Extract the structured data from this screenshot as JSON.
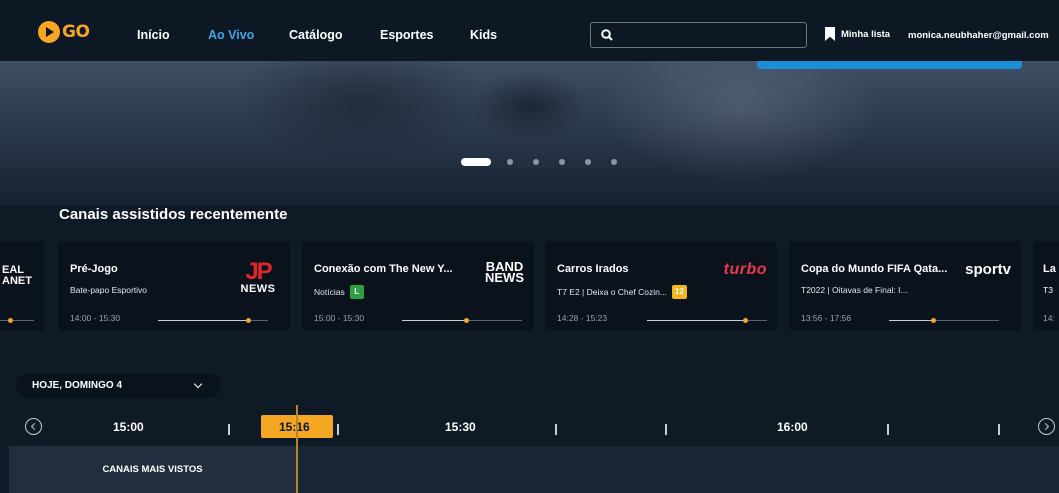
{
  "brand": {
    "logo_text": "GO"
  },
  "nav": {
    "items": [
      {
        "label": "Início",
        "active": false
      },
      {
        "label": "Ao Vivo",
        "active": true
      },
      {
        "label": "Catálogo",
        "active": false
      },
      {
        "label": "Esportes",
        "active": false
      },
      {
        "label": "Kids",
        "active": false
      }
    ],
    "search": {
      "placeholder": "",
      "value": ""
    },
    "my_list": "Minha lista",
    "user_email": "monica.neubhaher@gmail.com"
  },
  "hero": {
    "carousel_dots": 6,
    "active_dot": 0
  },
  "recent": {
    "title": "Canais assistidos recentemente",
    "partial_left": {
      "logo_line1": "EAL",
      "logo_line2": "ANET"
    },
    "cards": [
      {
        "title": "Pré-Jogo",
        "subtitle": "Bate-papo Esportivo",
        "badge": "",
        "time": "14:00 - 15:30",
        "progress": 0.82,
        "channel_logo": "jp-news-logo",
        "logo_text_1": "JP",
        "logo_text_2": "NEWS"
      },
      {
        "title": "Conexão com The New Y...",
        "subtitle": "Notícias",
        "badge": "L",
        "time": "15:00 - 15:30",
        "progress": 0.53,
        "channel_logo": "band-news-logo",
        "logo_text_1": "BAND",
        "logo_text_2": "NEWS"
      },
      {
        "title": "Carros Irados",
        "subtitle": "T7 E2 | Deixa o Chef Cozin...",
        "badge": "12",
        "time": "14:28 - 15:23",
        "progress": 0.82,
        "channel_logo": "discovery-turbo-logo",
        "logo_text_1": "turbo",
        "logo_text_2": ""
      },
      {
        "title": "Copa do Mundo FIFA Qata...",
        "subtitle": "T2022 | Oitavas de Final: I...",
        "badge": "",
        "time": "13:56 - 17:56",
        "progress": 0.4,
        "channel_logo": "sportv-logo",
        "logo_text_1": "sportv",
        "logo_text_2": ""
      }
    ],
    "partial_right": {
      "title": "La",
      "subtitle": "T3",
      "time": "14:"
    }
  },
  "schedule": {
    "date_label": "HOJE, DOMINGO 4",
    "times": [
      "15:00",
      "15:30",
      "16:00"
    ],
    "now_time": "15:16",
    "row_label": "CANAIS MAIS VISTOS"
  },
  "colors": {
    "accent": "#f5a623",
    "active_nav": "#3fa5e8",
    "background": "#0f1a27",
    "card": "#0a121c"
  }
}
